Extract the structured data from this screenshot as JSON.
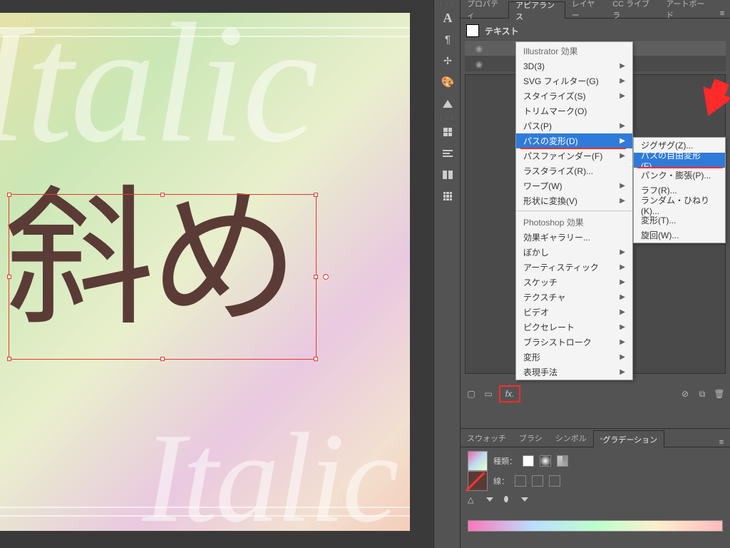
{
  "canvas": {
    "ghost_word": "Italic",
    "main_text": "斜め"
  },
  "panel_tabs": {
    "properties": "プロパティ",
    "appearance": "アピアランス",
    "layers": "レイヤー",
    "cc_lib": "CC ライブラ",
    "artboards": "アートボード"
  },
  "appearance": {
    "header_label": "テキスト",
    "fx_button": "fx."
  },
  "fx_menu": {
    "section_ai": "Illustrator 効果",
    "items_ai": [
      "3D(3)",
      "SVG フィルター(G)",
      "スタイライズ(S)",
      "トリムマーク(O)",
      "パス(P)",
      "パスの変形(D)",
      "パスファインダー(F)",
      "ラスタライズ(R)...",
      "ワープ(W)",
      "形状に変換(V)"
    ],
    "section_ps": "Photoshop 効果",
    "items_ps": [
      "効果ギャラリー...",
      "ぼかし",
      "アーティスティック",
      "スケッチ",
      "テクスチャ",
      "ビデオ",
      "ピクセレート",
      "ブラシストローク",
      "変形",
      "表現手法"
    ],
    "selected": "パスの変形(D)"
  },
  "fx_submenu": {
    "items": [
      "ジグザグ(Z)...",
      "パスの自由変形(F)...",
      "パンク・膨張(P)...",
      "ラフ(R)...",
      "ランダム・ひねり(K)...",
      "変形(T)...",
      "旋回(W)..."
    ],
    "selected": "パスの自由変形(F)..."
  },
  "grad_tabs": {
    "swatches": "スウォッチ",
    "brushes": "ブラシ",
    "symbols": "シンボル",
    "gradient": "グラデーション"
  },
  "gradient_panel": {
    "type_label": "種類：",
    "stroke_label": "線："
  }
}
